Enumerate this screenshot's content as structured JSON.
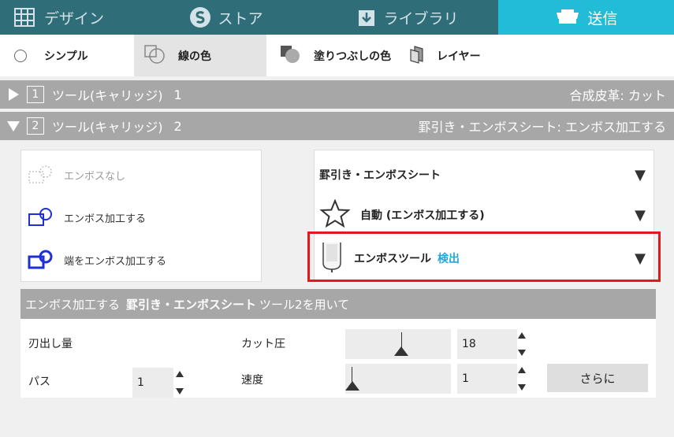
{
  "tabs": {
    "design": "デザイン",
    "store": "ストア",
    "library": "ライブラリ",
    "send": "送信"
  },
  "toolbar": {
    "simple": "シンプル",
    "line_color": "線の色",
    "fill_color": "塗りつぶしの色",
    "layer": "レイヤー"
  },
  "tool1": {
    "number": "1",
    "label": "ツール(キャリッジ)",
    "index": "1",
    "material": "合成皮革: カット"
  },
  "tool2": {
    "number": "2",
    "label": "ツール(キャリッジ)",
    "index": "2",
    "material": "罫引き・エンボスシート: エンボス加工する"
  },
  "emboss_options": {
    "none": "エンボスなし",
    "emboss": "エンボス加工する",
    "edge_emboss": "端をエンボス加工する"
  },
  "dropdowns": {
    "material": "罫引き・エンボスシート",
    "mode": "自動 (エンボス加工する)",
    "tool_name": "エンボスツール",
    "tool_status": "検出"
  },
  "settings": {
    "header_prefix": "エンボス加工する",
    "header_bold": "罫引き・エンボスシート",
    "header_suffix": "ツール2を用いて",
    "blade_depth_label": "刃出し量",
    "pass_label": "パス",
    "pass_value": "1",
    "force_label": "カット圧",
    "force_value": "18",
    "speed_label": "速度",
    "speed_value": "1",
    "more_button": "さらに"
  },
  "colors": {
    "tab_bar": "#2f6d79",
    "active_tab": "#22bcd8",
    "status_detected": "#22a7d8",
    "highlight": "#e0191e"
  }
}
